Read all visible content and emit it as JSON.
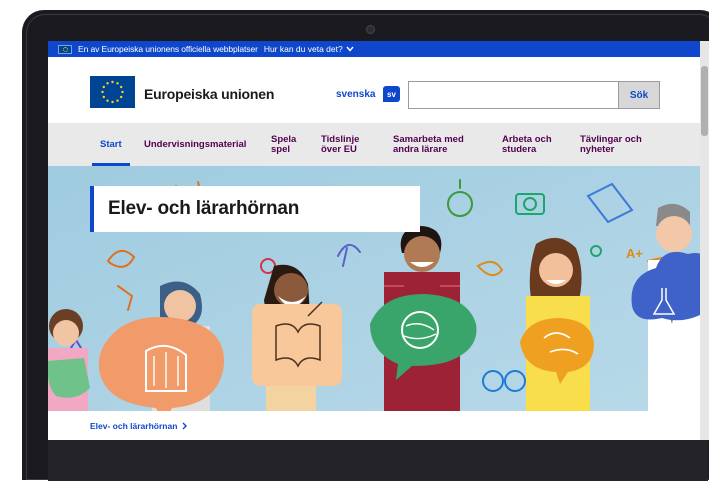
{
  "top_bar": {
    "official_text": "En av Europeiska unionens officiella webbplatser",
    "how_to_know": "Hur kan du veta det?",
    "chevron_icon": "chevron-down-icon"
  },
  "header": {
    "site_name": "Europeiska unionen",
    "language": "svenska",
    "language_code": "sv",
    "search_placeholder": "",
    "search_button": "Sök"
  },
  "nav": {
    "items": [
      {
        "label": "Start",
        "active": true
      },
      {
        "label": "Undervisningsmaterial",
        "active": false
      },
      {
        "label": "Spela spel",
        "active": false
      },
      {
        "label": "Tidslinje över EU",
        "active": false
      },
      {
        "label": "Samarbeta med andra lärare",
        "active": false
      },
      {
        "label": "Arbeta och studera",
        "active": false
      },
      {
        "label": "Tävlingar och nyheter",
        "active": false
      }
    ]
  },
  "hero": {
    "title": "Elev- och lärarhörnan"
  },
  "breadcrumb": {
    "link": "Elev- och lärarhörnan",
    "chevron_icon": "chevron-right-icon"
  },
  "colors": {
    "eu_blue": "#0e47cb",
    "nav_text": "#52004f",
    "nav_bg": "#e9e9e9",
    "flag_blue": "#004494",
    "flag_star": "#ffd617"
  }
}
